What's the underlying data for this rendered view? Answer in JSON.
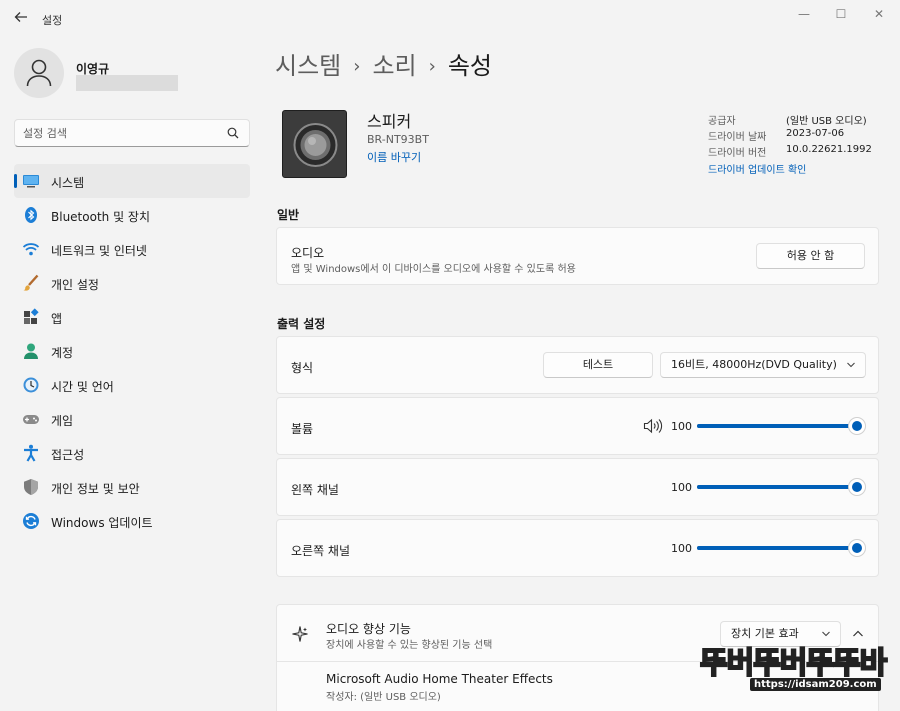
{
  "app": {
    "title": "설정",
    "back_icon": "back-arrow-icon"
  },
  "window_controls": {
    "minimize": "—",
    "maximize": "☐",
    "close": "✕"
  },
  "user": {
    "name": "이영규"
  },
  "search": {
    "placeholder": "설정 검색"
  },
  "sidebar": {
    "items": [
      {
        "label": "시스템",
        "icon": "system-icon",
        "active": true
      },
      {
        "label": "Bluetooth 및 장치",
        "icon": "bluetooth-icon"
      },
      {
        "label": "네트워크 및 인터넷",
        "icon": "network-icon"
      },
      {
        "label": "개인 설정",
        "icon": "personalization-icon"
      },
      {
        "label": "앱",
        "icon": "apps-icon"
      },
      {
        "label": "계정",
        "icon": "account-icon"
      },
      {
        "label": "시간 및 언어",
        "icon": "time-language-icon"
      },
      {
        "label": "게임",
        "icon": "gaming-icon"
      },
      {
        "label": "접근성",
        "icon": "accessibility-icon"
      },
      {
        "label": "개인 정보 및 보안",
        "icon": "privacy-shield-icon"
      },
      {
        "label": "Windows 업데이트",
        "icon": "windows-update-icon"
      }
    ]
  },
  "breadcrumb": {
    "items": [
      "시스템",
      "소리"
    ],
    "current": "속성",
    "separator": "›"
  },
  "device": {
    "name": "스피커",
    "model": "BR-NT93BT",
    "rename_link": "이름 바꾸기"
  },
  "driver": {
    "provider_label": "공급자",
    "provider_value": "(일반 USB 오디오)",
    "date_label": "드라이버 날짜",
    "date_value": "2023-07-06",
    "version_label": "드라이버 버전",
    "version_value": "10.0.22621.1992",
    "update_link": "드라이버 업데이트 확인"
  },
  "general": {
    "section_title": "일반",
    "audio_title": "오디오",
    "audio_desc": "앱 및 Windows에서 이 디바이스를 오디오에 사용할 수 있도록 허용",
    "audio_button": "허용 안 함"
  },
  "output": {
    "section_title": "출력 설정",
    "format_label": "형식",
    "test_button": "테스트",
    "format_value": "16비트, 48000Hz(DVD Quality)",
    "volume_label": "볼륨",
    "volume_value": 100,
    "volume_value_text": "100",
    "left_label": "왼쪽 채널",
    "left_value": 100,
    "left_value_text": "100",
    "right_label": "오른쪽 채널",
    "right_value": 100,
    "right_value_text": "100"
  },
  "enhancement": {
    "title": "오디오 향상 기능",
    "desc": "장치에 사용할 수 있는 향상된 기능 선택",
    "select_value": "장치 기본 효과",
    "item_title": "Microsoft Audio Home Theater Effects",
    "item_desc": "작성자: (일반 USB 오디오)"
  },
  "watermark": {
    "title": "뚜버뚜버뚜뚜바",
    "url": "https://idsam209.com"
  },
  "colors": {
    "accent": "#005fb8",
    "background": "#f3f3f3",
    "card": "#fbfbfb"
  }
}
